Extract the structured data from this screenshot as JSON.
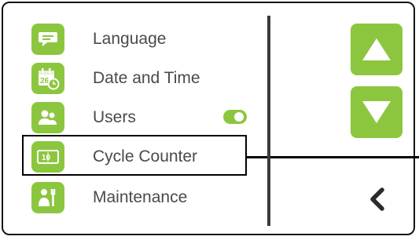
{
  "colors": {
    "accent": "#8cc63f",
    "text": "#4a4a4a",
    "divider": "#3a3a3a",
    "highlight_border": "#000000",
    "back_arrow": "#2b2b2b"
  },
  "menu": {
    "items": [
      {
        "label": "Language",
        "icon": "language-icon"
      },
      {
        "label": "Date and Time",
        "icon": "calendar-clock-icon"
      },
      {
        "label": "Users",
        "icon": "users-icon"
      },
      {
        "label": "Cycle Counter",
        "icon": "cycle-counter-icon"
      },
      {
        "label": "Maintenance",
        "icon": "maintenance-icon"
      }
    ]
  },
  "calendar_icon_number": "26",
  "cycle_counter_icon_digits": "10",
  "users_toggle": {
    "state": "on"
  },
  "highlighted_item": "Cycle Counter",
  "navigation": {
    "scroll_up": "arrow-up-icon",
    "scroll_down": "arrow-down-icon",
    "back": "chevron-left-icon"
  }
}
